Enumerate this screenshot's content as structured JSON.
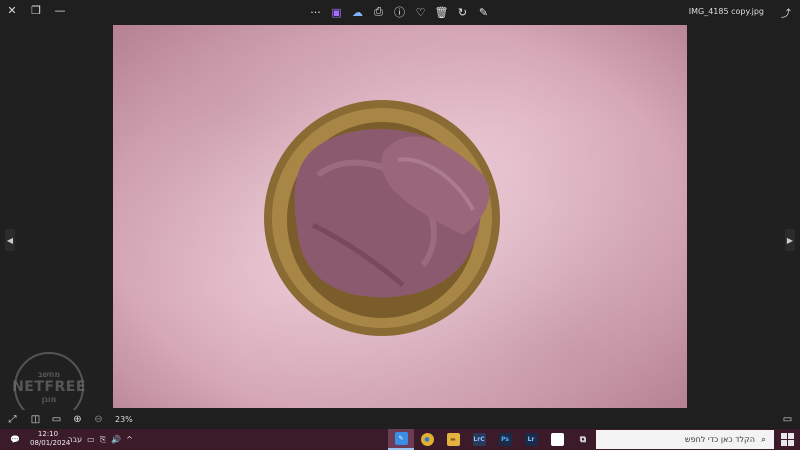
{
  "viewer": {
    "filename": "IMG_4185 copy.jpg",
    "zoom": "23%",
    "window_controls": {
      "close": "✕",
      "restore": "❐",
      "minimize": "—"
    },
    "toolbar_icons": [
      "more-icon",
      "album-icon",
      "onedrive-icon",
      "print-icon",
      "info-icon",
      "heart-icon",
      "delete-icon",
      "rotate-icon",
      "edit-icon"
    ],
    "toolbar_glyphs": [
      "···",
      "▣",
      "☁",
      "⎙",
      "ⓘ",
      "♡",
      "🗑",
      "↻",
      "✎"
    ],
    "share_glyph": "⤴",
    "prev_glyph": "◀",
    "next_glyph": "▶",
    "bottom_glyphs": [
      "⤢",
      "◫",
      "▭",
      "⊕",
      "⊖"
    ],
    "bottom_right_glyph": "▭"
  },
  "taskbar": {
    "time": "12:10",
    "date": "08/01/2024",
    "language": "עבר",
    "search_placeholder": "הקלד כאן כדי לחפש",
    "search_glyph": "⌕",
    "tray_glyphs": [
      "💬"
    ],
    "tray_icons_glyphs": [
      "▭",
      "⎘",
      "🔊",
      "^"
    ],
    "apps": [
      {
        "name": "pen-app",
        "label": "✎",
        "color": "#3a8ee6",
        "active": true
      },
      {
        "name": "chrome-app",
        "label": "●",
        "color": "#e0b030",
        "active": false
      },
      {
        "name": "file-explorer-app",
        "label": "▬",
        "color": "#e3b341",
        "active": false
      },
      {
        "name": "lightroom-classic-app",
        "label": "LrC",
        "color": "#2a3a5a",
        "active": false
      },
      {
        "name": "photoshop-app",
        "label": "Ps",
        "color": "#1b2b4a",
        "active": false
      },
      {
        "name": "lightroom-app",
        "label": "Lr",
        "color": "#1b2b4a",
        "active": false
      },
      {
        "name": "notepad-app",
        "label": "▯",
        "color": "#ffffff",
        "active": false
      },
      {
        "name": "task-view-app",
        "label": "⧉",
        "color": "#3b1b2a",
        "active": false
      }
    ]
  },
  "watermark": {
    "top": "מחשב",
    "middle": "NETFREE",
    "bottom": "מוגן"
  },
  "colors": {
    "background": "#1f1f1f",
    "taskbar": "#3b1b2a",
    "backdrop_pink": "#e9c5d1",
    "fabric": "#8f5a6e",
    "bowl": "#9a7a3c"
  }
}
